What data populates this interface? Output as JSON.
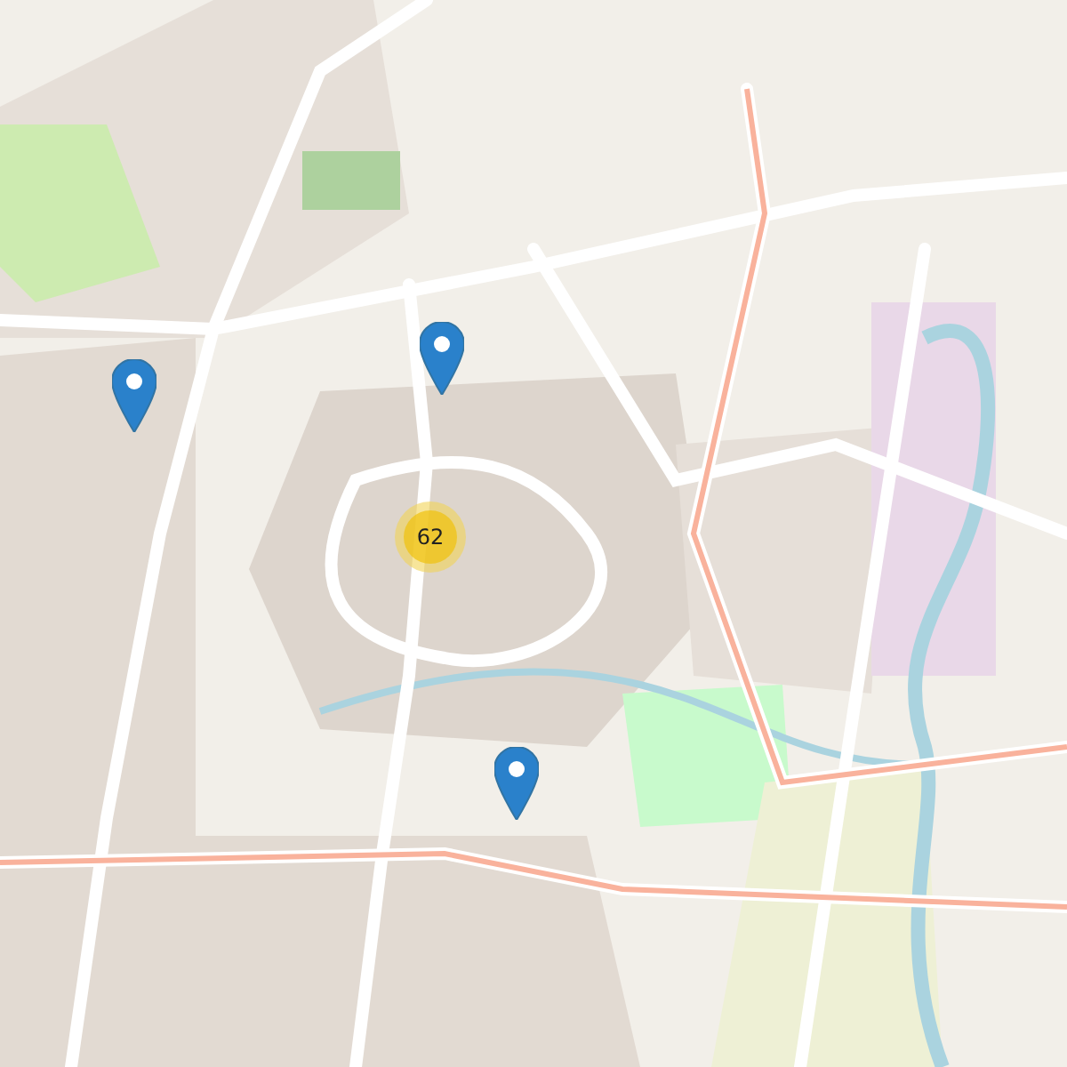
{
  "map": {
    "markers": [
      {
        "kind": "pin"
      },
      {
        "kind": "pin"
      },
      {
        "kind": "pin"
      }
    ],
    "clusters": [
      {
        "count": "62"
      }
    ]
  }
}
